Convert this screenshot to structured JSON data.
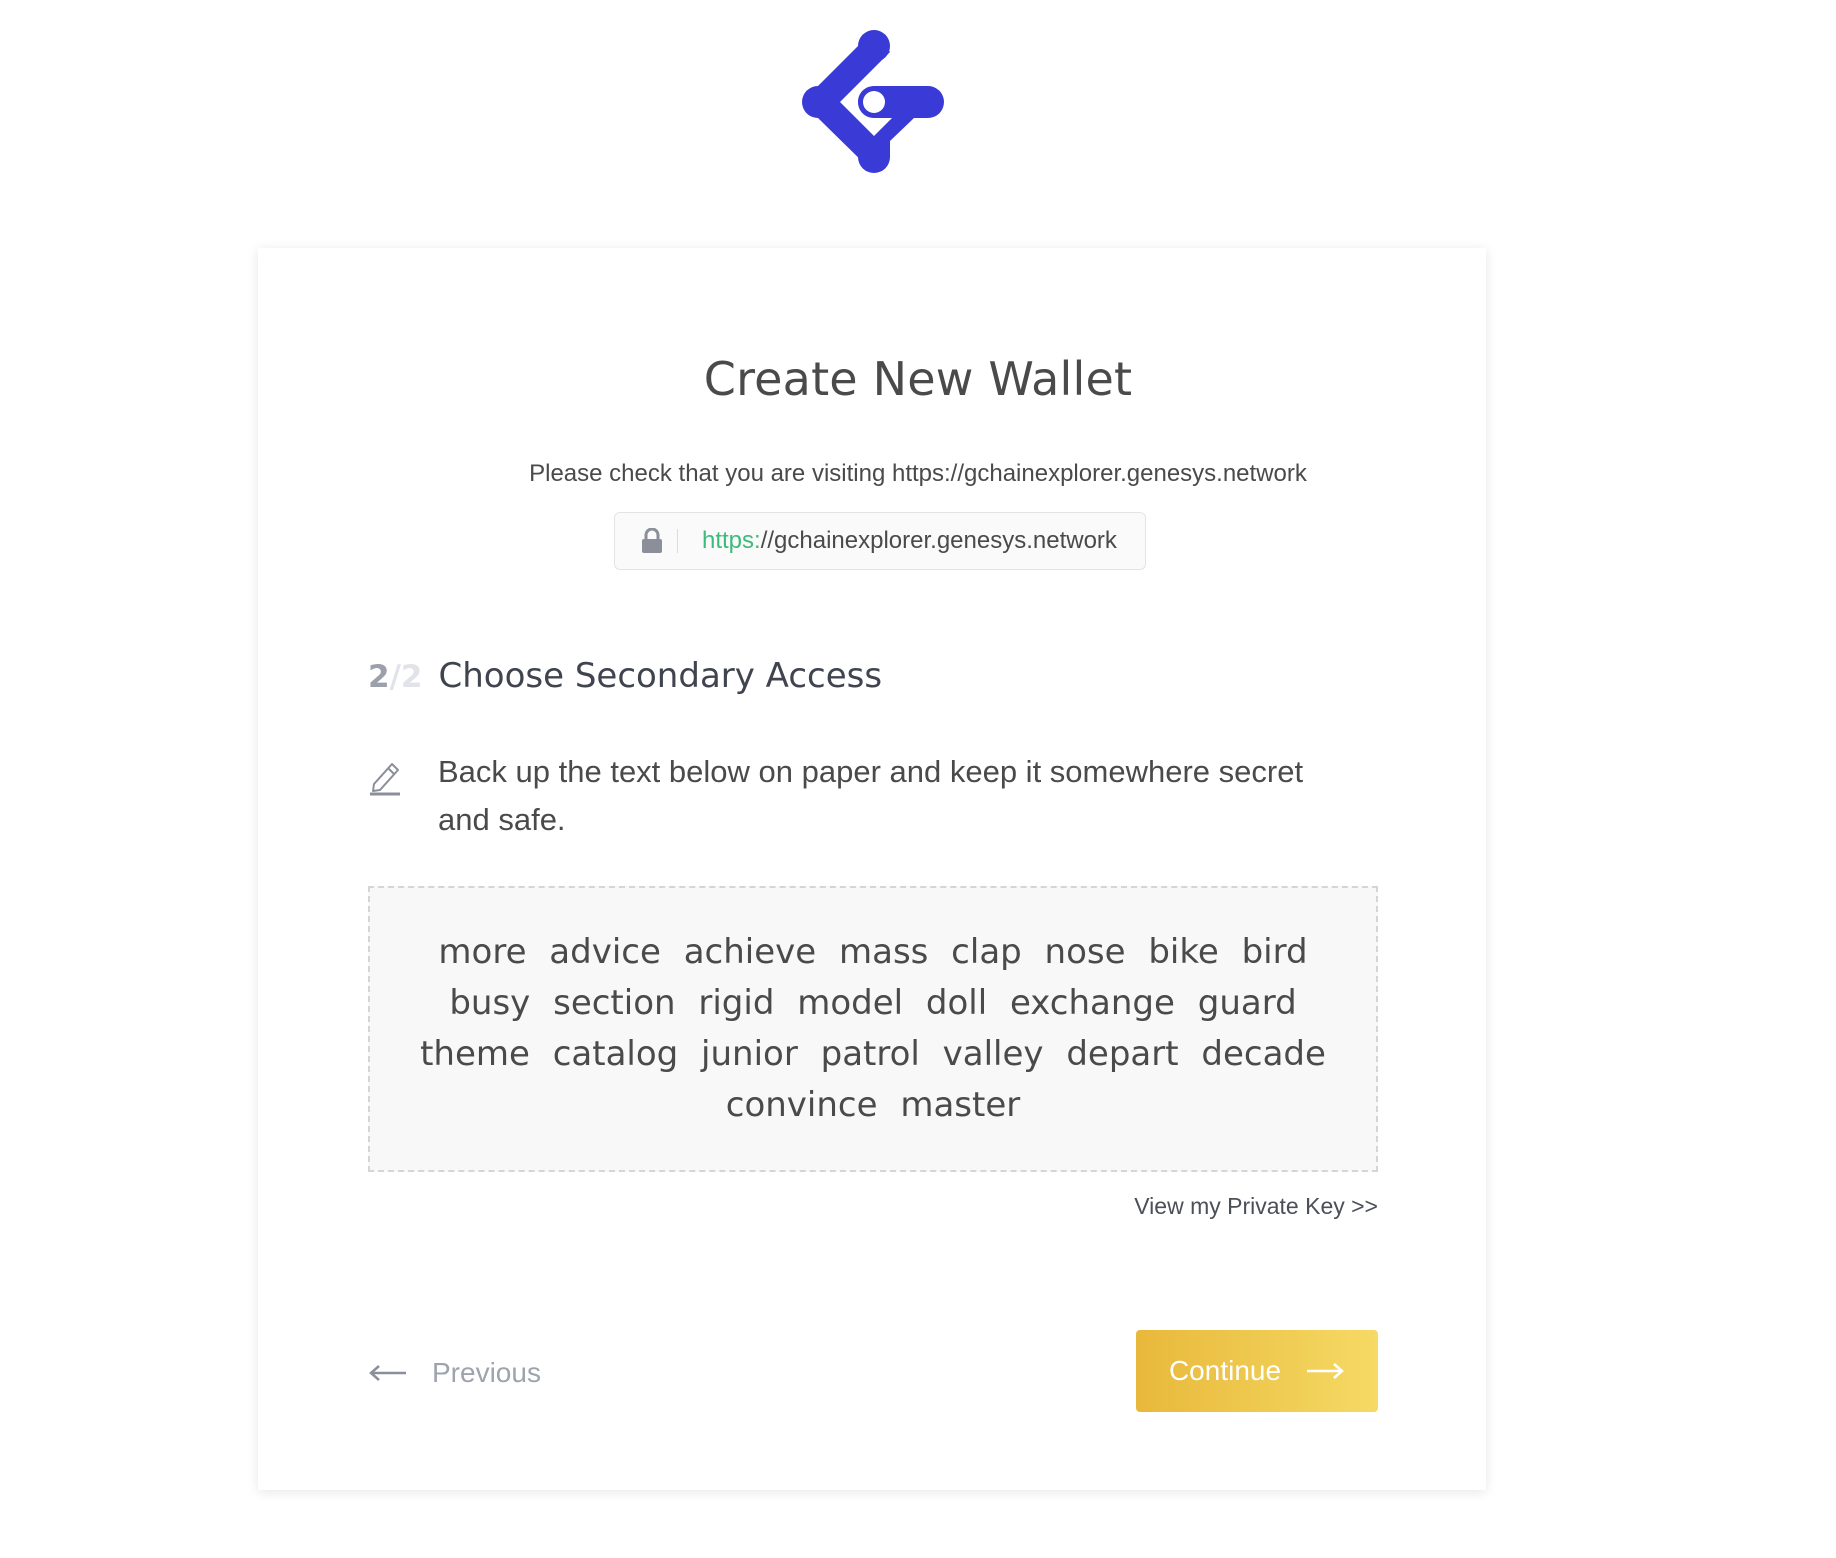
{
  "brand": {
    "logo_icon": "genesys-logo-icon",
    "logo_color": "#3a3ad6"
  },
  "page": {
    "title": "Create New Wallet",
    "check_notice": "Please check that you are visiting https://gchainexplorer.genesys.network"
  },
  "url_bar": {
    "lock_icon": "lock-icon",
    "protocol": "https:",
    "rest": "//gchainexplorer.genesys.network",
    "protocol_color": "#3dbb7a"
  },
  "step": {
    "current": "2",
    "separator": "/",
    "total": "2",
    "title": "Choose Secondary Access"
  },
  "instruction": {
    "icon": "pencil-icon",
    "text": "Back up the text below on paper and keep it somewhere secret and safe."
  },
  "mnemonic": {
    "phrase": "more advice achieve mass clap nose bike bird busy section rigid model doll exchange guard theme catalog junior patrol valley depart decade convince master"
  },
  "links": {
    "view_private_key": "View my Private Key >>"
  },
  "navigation": {
    "previous_label": "Previous",
    "continue_label": "Continue",
    "continue_gradient": [
      "#e8b83a",
      "#f5da65"
    ]
  }
}
